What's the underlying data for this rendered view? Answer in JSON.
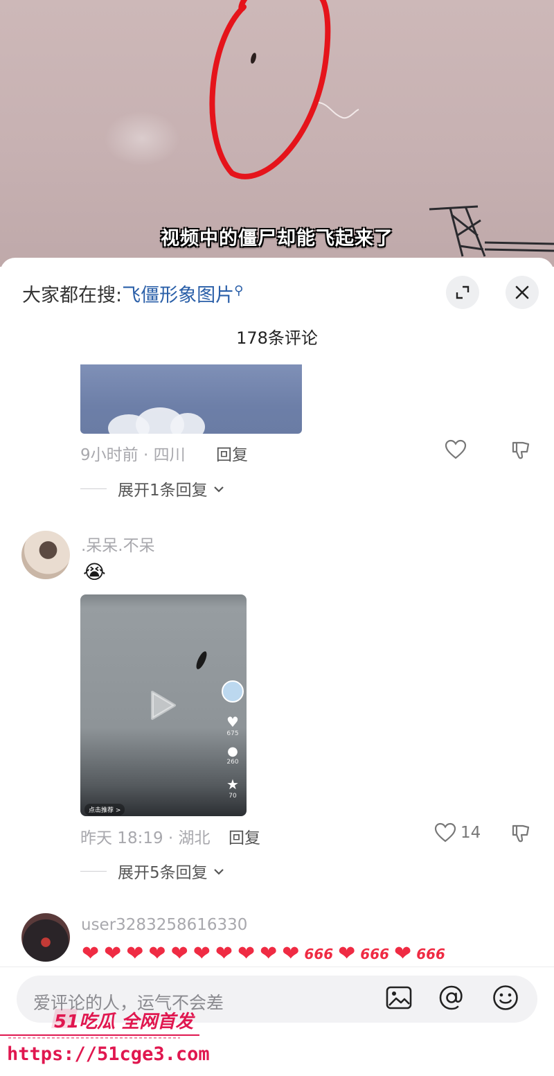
{
  "video": {
    "subtitle": "视频中的僵尸却能飞起来了"
  },
  "sheet": {
    "search_prefix": "大家都在搜:",
    "search_keyword": "飞僵形象图片",
    "comment_count_title": "178条评论"
  },
  "comments": [
    {
      "meta": "9小时前 · 四川",
      "reply_label": "回复",
      "likes": "",
      "expand_label": "展开1条回复"
    },
    {
      "username": ".呆呆.不呆",
      "emoji": "😭",
      "video_thumb": {
        "likes": "675",
        "comments": "260",
        "favorites": "70",
        "bottom_label": "点击推荐 >"
      },
      "meta": "昨天 18:19 · 湖北",
      "reply_label": "回复",
      "likes": "14",
      "expand_label": "展开5条回复"
    },
    {
      "username": "user3283258616330",
      "content_icons": [
        "heart",
        "heart",
        "heart",
        "heart",
        "heart",
        "heart",
        "heart",
        "heart",
        "heart",
        "heart",
        "666",
        "heart",
        "666",
        "heart",
        "666"
      ]
    }
  ],
  "input": {
    "placeholder": "爱评论的人，运气不会差"
  },
  "watermark": {
    "brand": "51吃瓜 全网首发",
    "url": "https://51cge3.com"
  },
  "colors": {
    "accent_link": "#2a5fa8",
    "heart_red": "#ef2b43",
    "watermark": "#e0174f",
    "circle_mark": "#e5141b"
  }
}
